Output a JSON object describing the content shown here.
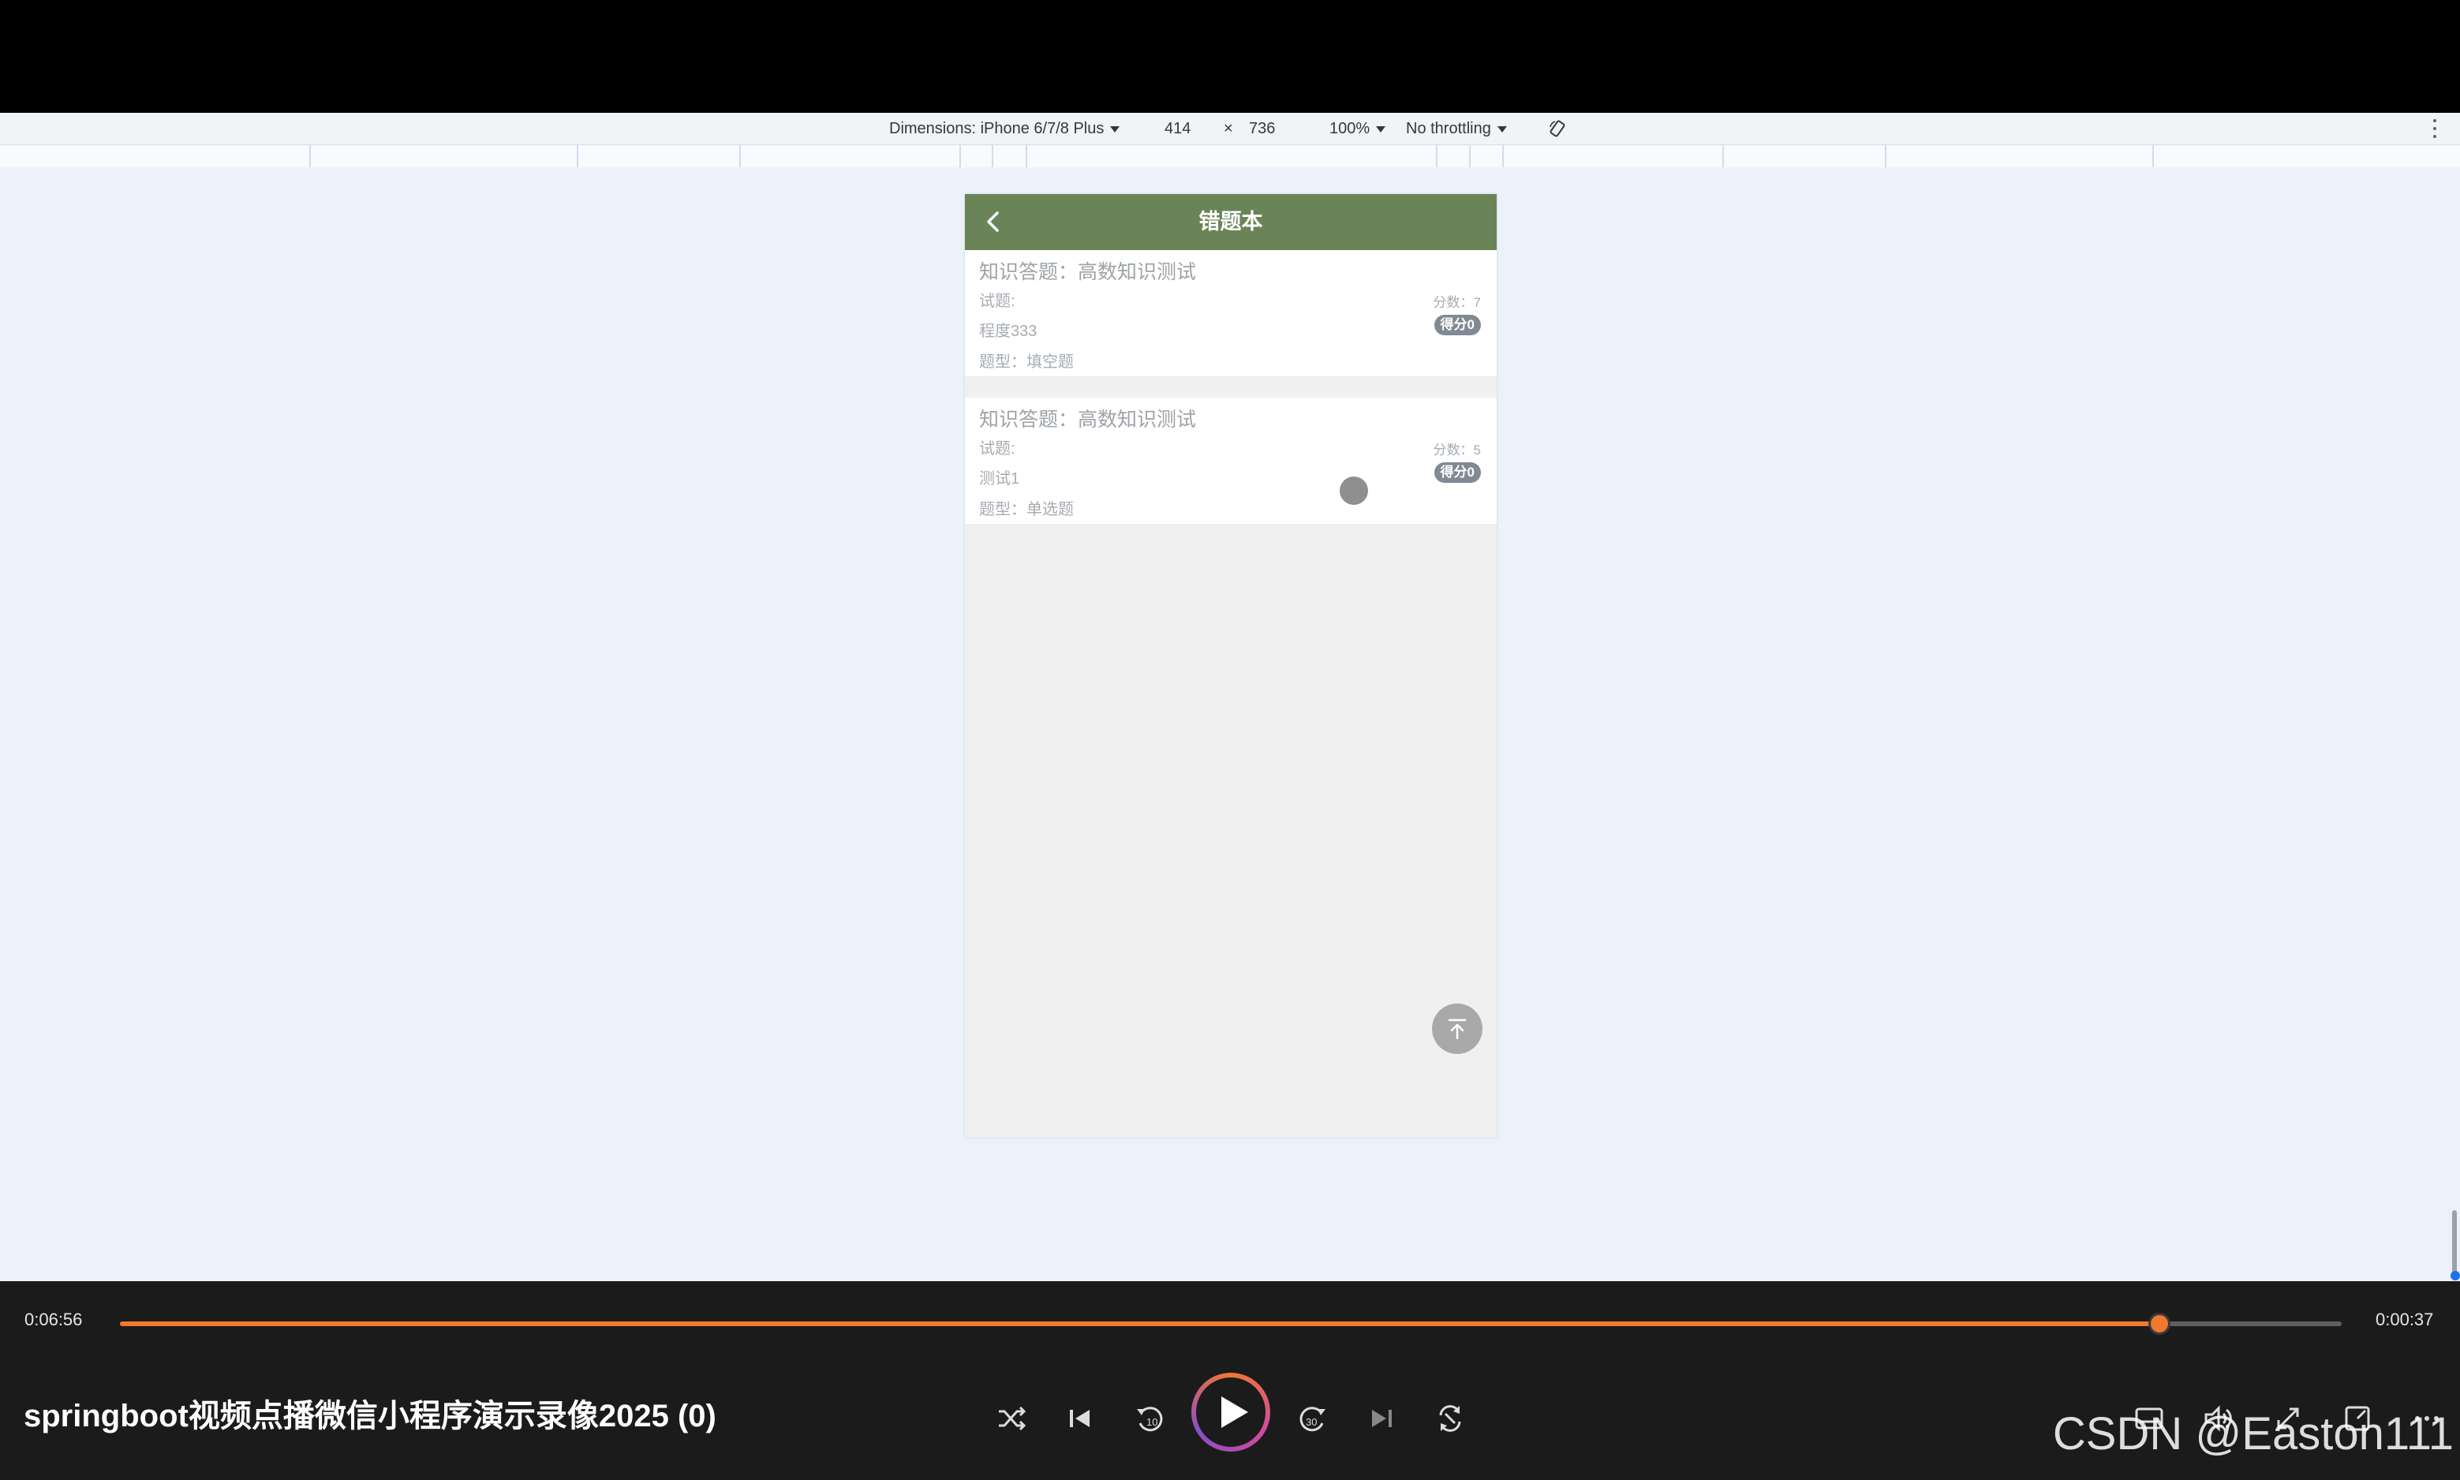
{
  "devtools": {
    "dimensions_label": "Dimensions: iPhone 6/7/8 Plus",
    "width": "414",
    "times": "×",
    "height": "736",
    "zoom": "100%",
    "throttling": "No throttling"
  },
  "app": {
    "title": "错题本",
    "cards": [
      {
        "title": "知识答题：高数知识测试",
        "question_label": "试题:",
        "question": "程度333",
        "type": "题型：填空题",
        "score": "分数：7",
        "badge": "得分0"
      },
      {
        "title": "知识答题：高数知识测试",
        "question_label": "试题:",
        "question": "测试1",
        "type": "题型：单选题",
        "score": "分数：5",
        "badge": "得分0"
      }
    ]
  },
  "player": {
    "elapsed": "0:06:56",
    "remaining": "0:00:37",
    "progress": 0.918,
    "title": "springboot视频点播微信小程序演示录像2025 (0)",
    "accent_color": "#f0782f"
  },
  "watermark": "CSDN @Easton111"
}
